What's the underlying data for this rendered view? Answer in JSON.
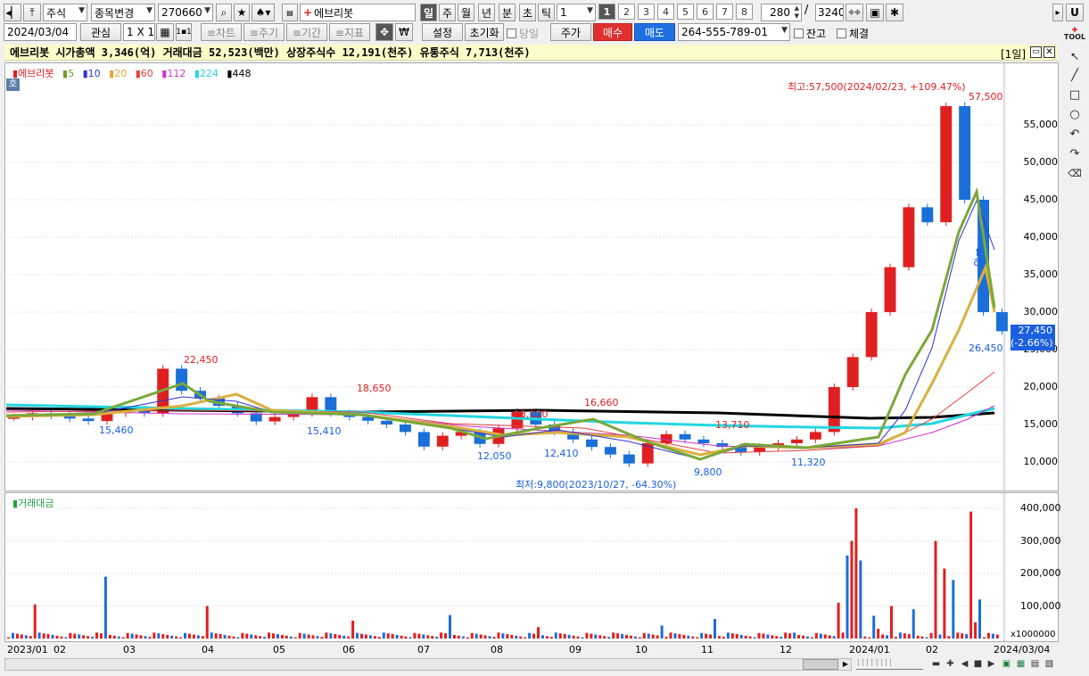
{
  "toolbar": {
    "market": "주식",
    "mode": "종목변경",
    "code": "270660",
    "name": "에브리봇",
    "periods": [
      "일",
      "주",
      "월",
      "년",
      "분",
      "초",
      "틱"
    ],
    "interval": "1",
    "pages": [
      "1",
      "2",
      "3",
      "4",
      "5",
      "6",
      "7",
      "8"
    ],
    "count": "280",
    "slash": "/",
    "total": "3240",
    "right_u": "U"
  },
  "toolbar2": {
    "date": "2024/03/04",
    "watch": "관심",
    "grid": "1 X 1",
    "one": "1▪1",
    "btn_chart": "≡차트",
    "btn_period": "≡주기",
    "btn_range": "≡기간",
    "btn_ind": "≡지표",
    "btn_setting": "설정",
    "btn_reset": "초기화",
    "chk_today": "당일",
    "btn_price": "주가",
    "btn_buy": "매수",
    "btn_sell": "매도",
    "account": "264-555-789-01",
    "chk_balance": "잔고",
    "chk_fill": "체결"
  },
  "ticker_text": "에브리봇  시가총액 3,346(억)  거래대금 52,523(백만)  상장주식수 12,191(천주)  유통주식 7,713(천주)",
  "panel_title": "[1일]",
  "legend": {
    "name": "에브리봇",
    "items": [
      {
        "label": "5",
        "color": "#6b9e2e"
      },
      {
        "label": "10",
        "color": "#3333cc"
      },
      {
        "label": "20",
        "color": "#e4a53a"
      },
      {
        "label": "60",
        "color": "#e04040"
      },
      {
        "label": "112",
        "color": "#cc33cc"
      },
      {
        "label": "224",
        "color": "#22d6e0"
      },
      {
        "label": "448",
        "color": "#000000"
      }
    ]
  },
  "ho_badge": "호",
  "price_axis": [
    "55,000",
    "50,000",
    "45,000",
    "40,000",
    "35,000",
    "30,000",
    "25,000",
    "20,000",
    "15,000",
    "10,000"
  ],
  "current_price": "27,450",
  "current_change": "(-2.66%)",
  "annotations": {
    "high": "최고:57,500(2024/02/23, +109.47%)",
    "high_value": "57,500",
    "low": "최저:9,800(2023/10/27, -64.30%)",
    "low_value": "9,800",
    "p22450": "22,450",
    "p18650": "18,650",
    "p16660": "16,660",
    "p13120": "13,120",
    "p13710": "13,710",
    "p15460": "15,460",
    "p15410": "15,410",
    "p12050": "12,050",
    "p12410": "12,410",
    "p11320": "11,320",
    "p26450": "26,450",
    "ha": "하"
  },
  "volume": {
    "title": "거래대금",
    "axis": [
      "400,000",
      "300,000",
      "200,000",
      "100,000"
    ],
    "unit": "x1000000"
  },
  "date_axis": [
    "2023/01",
    "02",
    "03",
    "04",
    "05",
    "06",
    "07",
    "08",
    "09",
    "10",
    "11",
    "12",
    "2024/01",
    "02"
  ],
  "date_end": "2024/03/04",
  "colors": {
    "up": "#e02020",
    "down": "#1a6fd8",
    "accent_blue": "#1a5fe0",
    "ticker_bg": "#fdfbc9"
  },
  "chart_data": {
    "type": "candlestick",
    "title": "에브리봇",
    "ylim": [
      8000,
      60000
    ],
    "high": 57500,
    "low": 9800,
    "last": 27450,
    "series": [
      {
        "name": "에브리봇",
        "values": [
          16000,
          16500,
          16200,
          15800,
          15460,
          16500,
          17000,
          16500,
          22450,
          19500,
          18500,
          17500,
          16500,
          15410,
          16000,
          16500,
          18650,
          16500,
          16000,
          15500,
          15000,
          14000,
          12050,
          13500,
          14000,
          12410,
          14500,
          16660,
          15000,
          14000,
          13000,
          12000,
          11000,
          9800,
          12500,
          13710,
          13000,
          12500,
          12000,
          11320,
          12000,
          12500,
          13000,
          14000,
          20000,
          24000,
          30000,
          36000,
          44000,
          42000,
          57500,
          45000,
          30000,
          27450
        ]
      }
    ]
  }
}
